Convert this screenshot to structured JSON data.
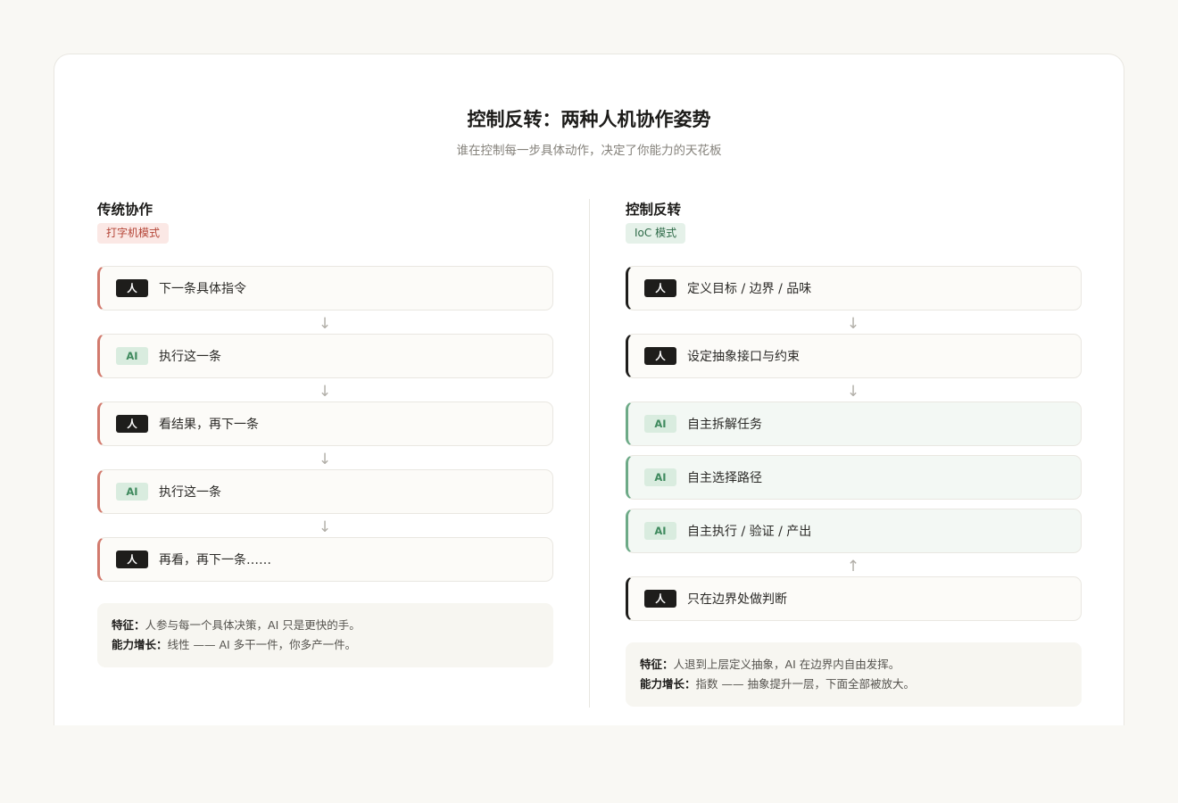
{
  "title": "控制反转：两种人机协作姿势",
  "subtitle": "谁在控制每一步具体动作，决定了你能力的天花板",
  "left": {
    "heading": "传统协作",
    "tag": "打字机模式",
    "steps": [
      {
        "actor": "人",
        "text": "下一条具体指令"
      },
      {
        "actor": "AI",
        "text": "执行这一条"
      },
      {
        "actor": "人",
        "text": "看结果，再下一条"
      },
      {
        "actor": "AI",
        "text": "执行这一条"
      },
      {
        "actor": "人",
        "text": "再看，再下一条……"
      }
    ],
    "arrows": [
      "↓",
      "↓",
      "↓",
      "↓"
    ],
    "note": {
      "feature_label": "特征：",
      "feature_text": "人参与每一个具体决策，AI 只是更快的手。",
      "growth_label": "能力增长：",
      "growth_text": "线性 —— AI 多干一件，你多产一件。"
    }
  },
  "right": {
    "heading": "控制反转",
    "tag": "IoC 模式",
    "steps": [
      {
        "actor": "人",
        "text": "定义目标 / 边界 / 品味"
      },
      {
        "actor": "人",
        "text": "设定抽象接口与约束"
      },
      {
        "actor": "AI",
        "text": "自主拆解任务"
      },
      {
        "actor": "AI",
        "text": "自主选择路径"
      },
      {
        "actor": "AI",
        "text": "自主执行 / 验证 / 产出"
      },
      {
        "actor": "人",
        "text": "只在边界处做判断"
      }
    ],
    "arrows": [
      "↓",
      "↓",
      "↑"
    ],
    "note": {
      "feature_label": "特征：",
      "feature_text": "人退到上层定义抽象，AI 在边界内自由发挥。",
      "growth_label": "能力增长：",
      "growth_text": "指数 —— 抽象提升一层，下面全部被放大。"
    }
  },
  "colors": {
    "background": "#f9f8f4",
    "human_chip": "#1e1d1b",
    "ai_chip_bg": "#d9ecdf",
    "ai_chip_text": "#3f8a5e",
    "traditional_accent": "#d27a6d",
    "ioc_accent_human": "#1e1d1b",
    "ioc_accent_ai": "#6daa87"
  }
}
